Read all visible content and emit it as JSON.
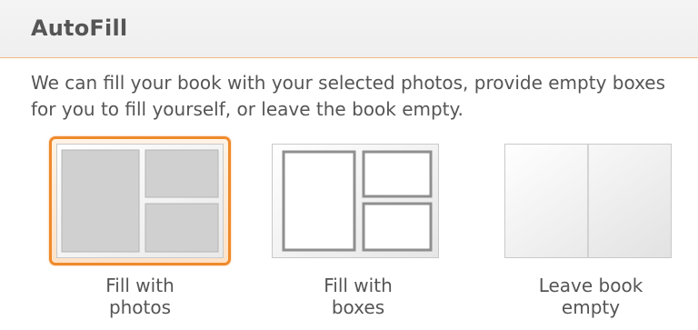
{
  "section": {
    "title": "AutoFill",
    "description_line1": "We can fill your book with your selected photos, provide empty boxes",
    "description_line2": "for you to fill yourself, or leave the book empty."
  },
  "options": [
    {
      "label_line1": "Fill with",
      "label_line2": "photos",
      "selected": true,
      "icon": "fill-with-photos-icon"
    },
    {
      "label_line1": "Fill with",
      "label_line2": "boxes",
      "selected": false,
      "icon": "fill-with-boxes-icon"
    },
    {
      "label_line1": "Leave book",
      "label_line2": "empty",
      "selected": false,
      "icon": "leave-book-empty-icon"
    }
  ],
  "colors": {
    "accent": "#ef8a2b",
    "text": "#555555",
    "header_rule": "#f5b77e"
  }
}
